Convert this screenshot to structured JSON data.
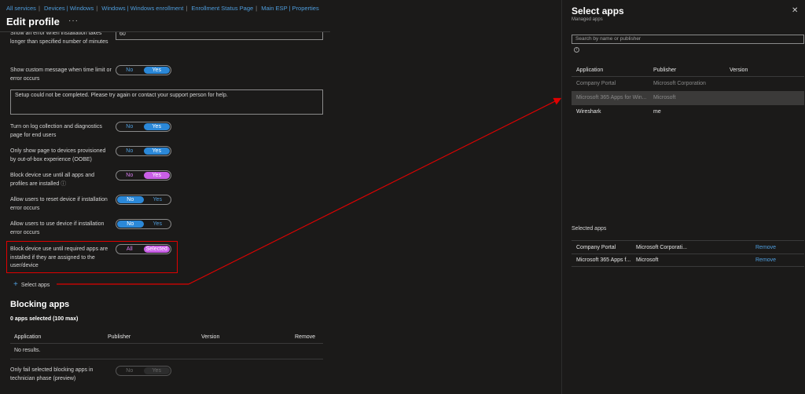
{
  "breadcrumb": [
    "All services",
    "Devices | Windows",
    "Windows | Windows enrollment",
    "Enrollment Status Page",
    "Main ESP | Properties"
  ],
  "page_title": "Edit profile",
  "more_label": "···",
  "settings": {
    "partial_label": "Show an error when installation takes longer than specified number of minutes",
    "partial_value": "60",
    "custom_message_label": "Show custom message when time limit or error occurs",
    "custom_message_text": "Setup could not be completed. Please try again or contact your support person for help.",
    "log_collection_label": "Turn on log collection and diagnostics page for end users",
    "oobe_label": "Only show page to devices provisioned by out-of-box experience (OOBE)",
    "block_all_label": "Block device use until all apps and profiles are installed",
    "reset_label": "Allow users to reset device if installation error occurs",
    "use_device_label": "Allow users to use device if installation error occurs",
    "block_required_label": "Block device use until required apps are installed if they are assigned to the user/device",
    "no": "No",
    "yes": "Yes",
    "all": "All",
    "selected": "Selected",
    "info_glyph": "ⓘ"
  },
  "select_apps_link": "Select apps",
  "blocking": {
    "title": "Blocking apps",
    "count": "0 apps selected (100 max)",
    "headers": [
      "Application",
      "Publisher",
      "Version",
      "Remove"
    ],
    "empty": "No results.",
    "technician_label": "Only fail selected blocking apps in technician phase (preview)"
  },
  "panel": {
    "title": "Select apps",
    "subtitle": "Managed apps",
    "search_placeholder": "Search by name or publisher",
    "headers": [
      "Application",
      "Publisher",
      "Version"
    ],
    "apps": [
      {
        "name": "Company Portal",
        "publisher": "Microsoft Corporation",
        "dim": true
      },
      {
        "name": "Microsoft 365 Apps for Win...",
        "publisher": "Microsoft",
        "dim": true
      },
      {
        "name": "Wireshark",
        "publisher": "me",
        "dim": false
      }
    ],
    "selected_title": "Selected apps",
    "selected": [
      {
        "name": "Company Portal",
        "publisher": "Microsoft Corporati...",
        "action": "Remove"
      },
      {
        "name": "Microsoft 365 Apps f...",
        "publisher": "Microsoft",
        "action": "Remove"
      }
    ]
  },
  "colors": {
    "accent": "#2b88d8",
    "pink": "#c95fe6",
    "red_annotation": "#e00000"
  }
}
